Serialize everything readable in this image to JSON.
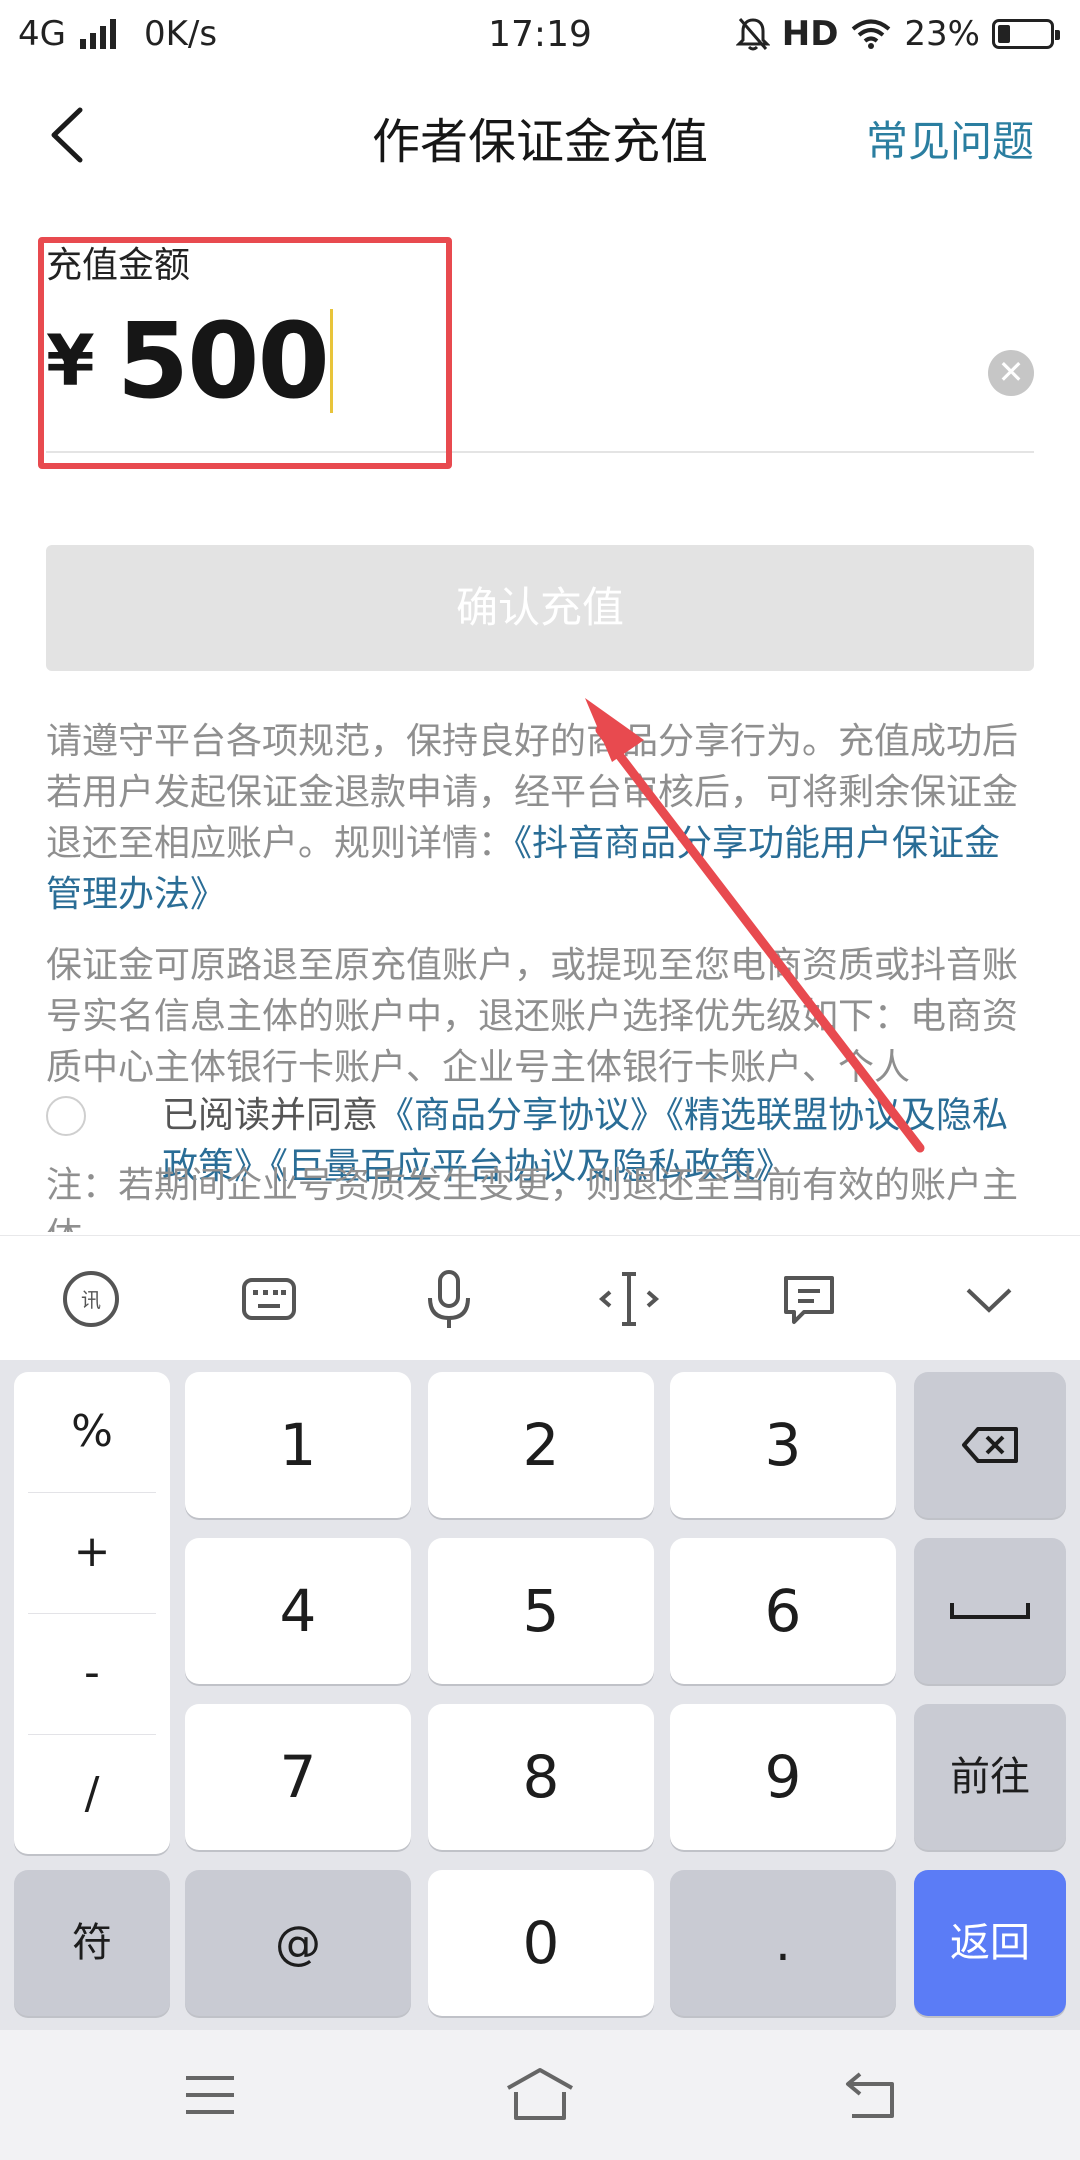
{
  "status_bar": {
    "network": "4G",
    "speed": "0K/s",
    "time": "17:19",
    "hd": "HD",
    "battery_percent": "23%",
    "battery_level": 0.23
  },
  "header": {
    "title": "作者保证金充值",
    "faq_link": "常见问题"
  },
  "amount": {
    "label": "充值金额",
    "currency": "¥",
    "value": "500"
  },
  "confirm_button": "确认充值",
  "paragraph1": {
    "text": "请遵守平台各项规范，保持良好的商品分享行为。充值成功后若用户发起保证金退款申请，经平台审核后，可将剩余保证金退还至相应账户。规则详情：",
    "link": "《抖音商品分享功能用户保证金管理办法》"
  },
  "paragraph2": {
    "text": "保证金可原路退至原充值账户，或提现至您电商资质或抖音账号实名信息主体的账户中，退还账户选择优先级如下：电商资质中心主体银行卡账户、企业号主体银行卡账户、个人"
  },
  "agreement": {
    "prefix": "已阅读并同意",
    "link1": "《商品分享协议》",
    "link2": "《精选联盟协议及隐私政策》",
    "link3": "《巨量百应平台协议及隐私政策》"
  },
  "paragraph3": {
    "text": "注：若期间企业号资质发生变更，则退还至当前有效的账户主体"
  },
  "keyboard": {
    "side_keys": [
      "%",
      "+",
      "-",
      "/"
    ],
    "row1": [
      "1",
      "2",
      "3"
    ],
    "row2": [
      "4",
      "5",
      "6"
    ],
    "row3": [
      "7",
      "8",
      "9"
    ],
    "symbols_key": "符",
    "at_key": "@",
    "zero_key": "0",
    "dot_key": ".",
    "go_key": "前往",
    "return_key": "返回",
    "accent": "#5b7cf6"
  },
  "colors": {
    "link": "#2a6d96",
    "highlight_box": "#e84a4f",
    "arrow": "#e84a4f"
  }
}
